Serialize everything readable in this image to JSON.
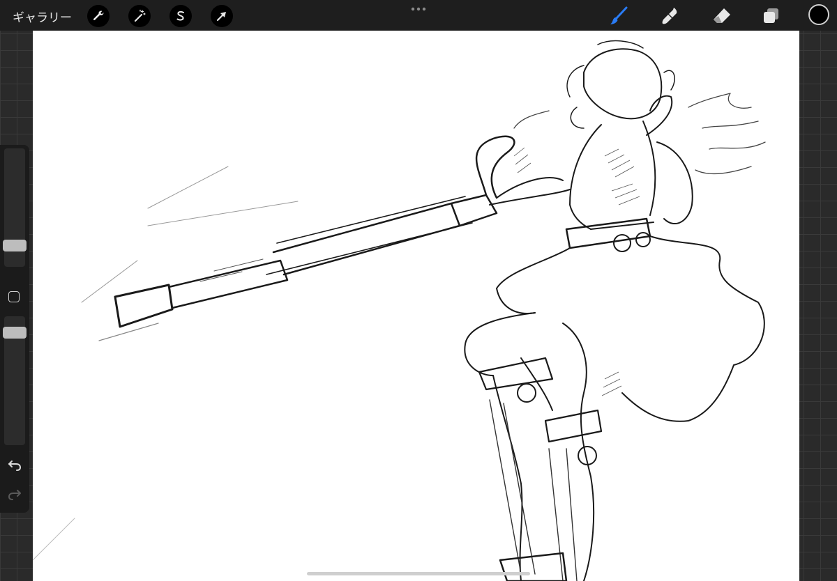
{
  "topbar": {
    "gallery_label": "ギャラリー",
    "left_tools": [
      "wrench-icon",
      "magic-wand-icon",
      "selection-s-icon",
      "transform-arrow-icon"
    ],
    "more_icon": "more-dots-icon",
    "right_tools": [
      "brush-icon",
      "smudge-icon",
      "eraser-icon",
      "layers-icon"
    ],
    "active_tool": "brush-icon",
    "active_color": "#000000",
    "accent_color": "#2a7cf6"
  },
  "sidebar": {
    "brush_size_slider": "brush-size",
    "opacity_slider": "opacity",
    "modifier_icon": "modifier-square-icon",
    "undo_icon": "undo-icon",
    "redo_icon": "redo-icon"
  },
  "canvas": {
    "background": "#ffffff",
    "content": "line-art-sketch"
  }
}
